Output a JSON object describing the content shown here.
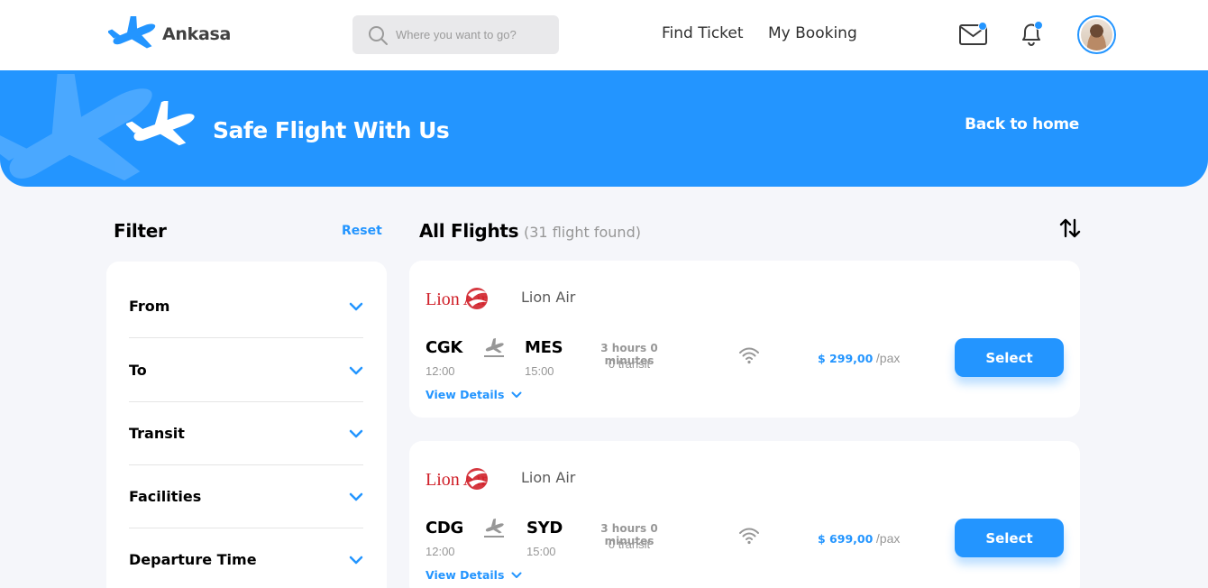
{
  "header": {
    "brand": "Ankasa",
    "search_placeholder": "Where you want to go?",
    "nav": [
      "Find Ticket",
      "My Booking"
    ],
    "accent_color": "#2395FF"
  },
  "banner": {
    "title": "Safe Flight With Us",
    "back_label": "Back to home"
  },
  "filter": {
    "title": "Filter",
    "reset_label": "Reset",
    "items": [
      "From",
      "To",
      "Transit",
      "Facilities",
      "Departure Time"
    ]
  },
  "flights": {
    "title": "All Flights",
    "count_text": "(31 flight found)",
    "list": [
      {
        "airline_logo_text": "Lion Air",
        "airline": "Lion Air",
        "from": "CGK",
        "from_time": "12:00",
        "to": "MES",
        "to_time": "15:00",
        "duration": "3 hours 0 minutes",
        "transit": "0 transit",
        "price": "$ 299,00",
        "per": "/pax",
        "select_label": "Select",
        "details_label": "View Details"
      },
      {
        "airline_logo_text": "Lion Air",
        "airline": "Lion Air",
        "from": "CDG",
        "from_time": "12:00",
        "to": "SYD",
        "to_time": "15:00",
        "duration": "3 hours 0 minutes",
        "transit": "0 transit",
        "price": "$ 699,00",
        "per": "/pax",
        "select_label": "Select",
        "details_label": "View Details"
      }
    ]
  }
}
